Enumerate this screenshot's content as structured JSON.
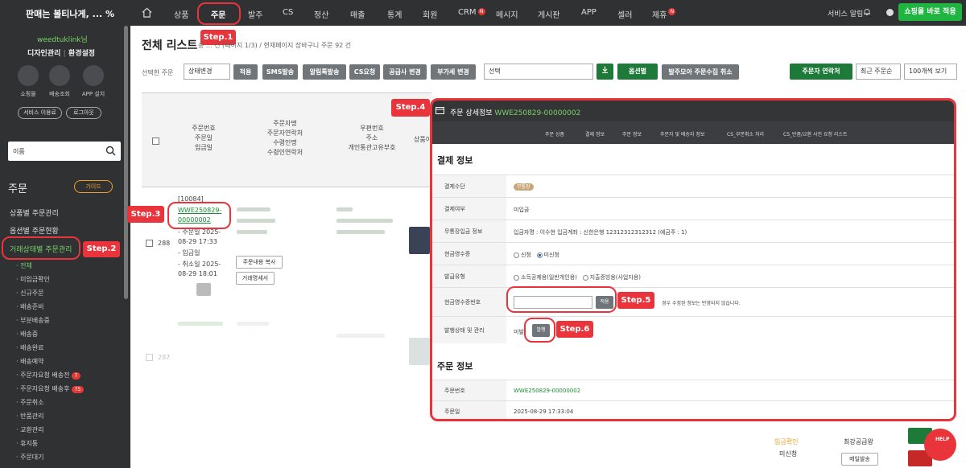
{
  "topbar": {
    "brand": "판매는 볼티나게, ... %",
    "nav": [
      {
        "label": "상품"
      },
      {
        "label": "주문"
      },
      {
        "label": "발주"
      },
      {
        "label": "CS"
      },
      {
        "label": "정산"
      },
      {
        "label": "매출"
      },
      {
        "label": "통계"
      },
      {
        "label": "회원"
      },
      {
        "label": "CRM"
      },
      {
        "label": "메시지"
      },
      {
        "label": "게시판"
      },
      {
        "label": "APP"
      },
      {
        "label": "셀러"
      },
      {
        "label": "제휴"
      }
    ],
    "service_alert": "서비스 알림",
    "shop_apply": "쇼핑몰 바로 적용",
    "new_badge": "N"
  },
  "sidebar": {
    "user": "weedtuklink님",
    "link_design": "디자인관리",
    "link_env": "환경설정",
    "icons": [
      {
        "label": "쇼핑몰"
      },
      {
        "label": "배송조회"
      },
      {
        "label": "APP 설치"
      }
    ],
    "service_use": "서비스 이용료",
    "logout": "로그아웃",
    "search_select": "이름",
    "section_title": "주문",
    "guide": "가이드",
    "menus": [
      {
        "label": "상품별 주문관리"
      },
      {
        "label": "옵션별 주문현황"
      },
      {
        "label": "거래상태별 주문관리"
      }
    ],
    "subs": [
      {
        "label": "· 전체"
      },
      {
        "label": "· 미입금확인"
      },
      {
        "label": "· 신규주문"
      },
      {
        "label": "· 배송준비"
      },
      {
        "label": "· 부분배송중"
      },
      {
        "label": "· 배송중"
      },
      {
        "label": "· 배송완료"
      },
      {
        "label": "· 배송예약"
      },
      {
        "label": "· 주문자요청 배송전",
        "count": "7"
      },
      {
        "label": "· 주문자요청 배송후",
        "count": "75"
      },
      {
        "label": "· 주문취소"
      },
      {
        "label": "· 반품관리"
      },
      {
        "label": "· 교환관리"
      },
      {
        "label": "· 휴지통"
      },
      {
        "label": "· 주문대기"
      }
    ]
  },
  "steps": {
    "s1": "Step.1",
    "s2": "Step.2",
    "s3": "Step.3",
    "s4": "Step.4",
    "s5": "Step.5",
    "s6": "Step.6"
  },
  "main": {
    "title": "전체 리스트",
    "summary": "총 ... 건 (페이지 1/3) / 현재페이지 장바구니 주문 92 건",
    "selected_label": "선택한 주문",
    "status_select": "상태변경",
    "buttons": [
      "적용",
      "SMS발송",
      "알림톡발송",
      "CS요청",
      "공급사 변경",
      "부가세 변경"
    ],
    "choose_select": "선택",
    "option_btn": "옵션별",
    "bulk_cancel": "발주모아 주문수집 취소",
    "contact_btn": "주문자 연락처",
    "sort_select": "최근 주문순",
    "page_size": "100개씩 보기"
  },
  "table": {
    "headers": {
      "order": [
        "주문번호",
        "주문일",
        "입금일"
      ],
      "buyer": [
        "주문자명",
        "주문자연락처",
        "수령인명",
        "수령인연락처"
      ],
      "addr": [
        "우편번호",
        "주소",
        "개인통관고유부호"
      ],
      "product": "상품이"
    },
    "row": {
      "no": "288",
      "code": "[10084]",
      "order_id": "WWE250829-00000002",
      "order_date": "- 주문일 2025-08-29 17:33",
      "paid": "- 입금일",
      "cancel_date": "- 취소일 2025-08-29 18:01",
      "copy_btn": "주문내용 복사",
      "statement_btn": "거래명세서"
    },
    "row2_no": "287",
    "right_status": "입금확인",
    "right_sub": "미신청",
    "supplier": "최강공급왕",
    "mail_btn": "메일발송"
  },
  "modal": {
    "title": "주문 상세정보",
    "order_id": "WWE250829-00000002",
    "tabs": [
      "주문 상품",
      "결제 정보",
      "주문 정보",
      "주문자 및 배송지 정보",
      "CS_부분취소 처리",
      "CS_반품/교환 사진 요청 리스트"
    ],
    "section_payment": "결제 정보",
    "rows": {
      "method_label": "결제수단",
      "method_val": "무통장",
      "paid_label": "결제여부",
      "paid_val": "미입금",
      "bank_label": "무통장입금 정보",
      "bank_val": "입금자명 : 이수현  입금계좌 : 신한은행 12312312312312 (예금주 : 1)",
      "receipt_label": "현금영수증",
      "receipt_opt1": "신청",
      "receipt_opt2": "미신청",
      "type_label": "발급유형",
      "type_opt1": "소득공제용(일반개인용)",
      "type_opt2": "지출증빙용(사업자용)",
      "receipt_no_label": "현금영수증번호",
      "apply_btn": "적용",
      "receipt_note": "경우 수정된 정보는 반영되지 않습니다.",
      "issue_label": "발행상태 및 관리",
      "issue_status": "미발",
      "issue_btn": "발행"
    },
    "section_order": "주문 정보",
    "order_rows": {
      "no_label": "주문번호",
      "no_val": "WWE250829-00000002",
      "date_label": "주문일",
      "date_val": "2025-08-29 17:33:04"
    }
  },
  "help": "HELP",
  "colors": {
    "accent": "#e8343a",
    "green": "#1fb540",
    "dark": "#2f3133"
  }
}
